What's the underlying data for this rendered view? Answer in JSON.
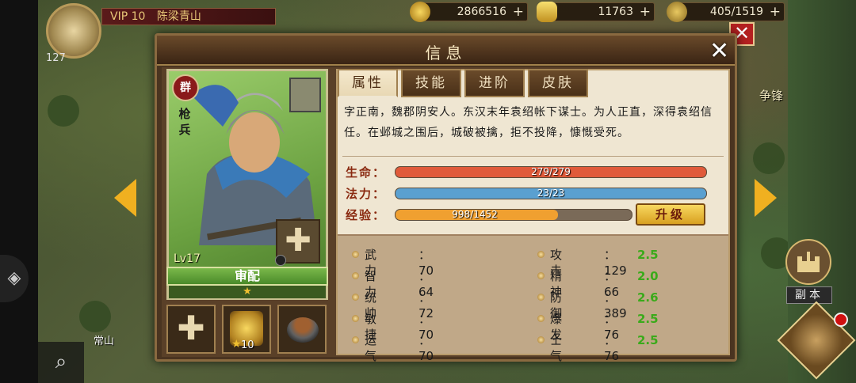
{
  "top_bar": {
    "level": "127",
    "vip_label": "VIP 10",
    "player_name": "陈梁青山",
    "copper": "2866516",
    "gold": "11763",
    "food": "405/1519"
  },
  "dialog": {
    "title": "信息",
    "tabs": [
      "属性",
      "技能",
      "进阶",
      "皮肤"
    ],
    "active_tab": 0
  },
  "hero": {
    "faction": "群",
    "unit_type": "枪兵",
    "level": "Lv17",
    "name": "审配",
    "stars": 1,
    "bio": "字正南，魏郡阴安人。东汉末年袁绍帐下谋士。为人正直，深得袁绍信任。在邺城之围后，城破被擒，拒不投降，慷慨受死。",
    "equip_count": "10"
  },
  "bars": {
    "hp": {
      "label": "生命：",
      "text": "279/279",
      "fraction": 1.0,
      "color": "#e05a3a"
    },
    "mp": {
      "label": "法力：",
      "text": "23/23",
      "fraction": 1.0,
      "color": "#5aa0d0"
    },
    "exp": {
      "label": "经验：",
      "text": "998/1452",
      "fraction": 0.687,
      "color": "#f0a030"
    }
  },
  "levelup_label": "升级",
  "attributes_left": [
    {
      "name": "武力",
      "value": "：70",
      "growth": "2.5"
    },
    {
      "name": "智力",
      "value": "：64",
      "growth": "2.0"
    },
    {
      "name": "统帅",
      "value": "：72",
      "growth": "2.6"
    },
    {
      "name": "敏捷",
      "value": "：70",
      "growth": "2.5"
    },
    {
      "name": "运气",
      "value": "：70",
      "growth": "2.5"
    }
  ],
  "attributes_right": [
    {
      "name": "攻击",
      "value": "：129"
    },
    {
      "name": "精神",
      "value": "：66"
    },
    {
      "name": "防御",
      "value": "：389"
    },
    {
      "name": "爆发",
      "value": "：76"
    },
    {
      "name": "士气",
      "value": "：76"
    }
  ],
  "hud": {
    "dungeon_label": "副本",
    "map_label": "常山",
    "map_text_right": "争锋"
  }
}
